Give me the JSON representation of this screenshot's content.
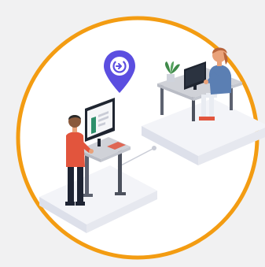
{
  "illustration": {
    "subject": "hybrid-workspace",
    "icons": [
      "location-pin-icon",
      "desk-booking-icon"
    ],
    "colors": {
      "background": "#f1f1f2",
      "circle_ring": "#f39c12",
      "circle_fill": "#ffffff",
      "platform": "#f3f4f8",
      "platform_edge": "#dde0ea",
      "pin": "#5b4ee0",
      "monitor": "#1f2530",
      "screen_accent": "#2e8f6b",
      "desk_top": "#d0d2d8",
      "desk_frame": "#5d6270",
      "person_standing_shirt": "#e2553d",
      "person_standing_pants": "#1e2433",
      "person_seated_shirt": "#5b7fb3",
      "person_seated_pants": "#e9ecf2",
      "person_seated_hair": "#b8643a",
      "shoes_red": "#e2553d",
      "plant_leaves": "#3f8a4a",
      "plant_pot": "#cfd3dc",
      "skin": "#e9a27a",
      "hair_dark": "#2a2a2a"
    }
  }
}
